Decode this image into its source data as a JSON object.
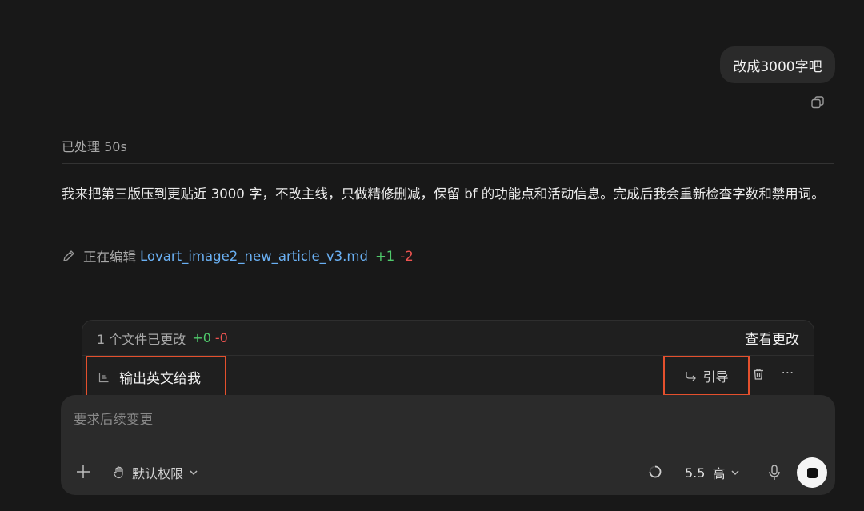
{
  "conversation": {
    "user_message": "改成3000字吧",
    "processed_label": "已处理 50s",
    "assistant_reply": "我来把第三版压到更贴近 3000 字，不改主线，只做精修删减，保留 bf 的功能点和活动信息。完成后我会重新检查字数和禁用词。",
    "edit_status": {
      "prefix": "正在编辑",
      "file_name": "Lovart_image2_new_article_v3.md",
      "added": "+1",
      "removed": "-2"
    }
  },
  "changes_panel": {
    "summary": "1 个文件已更改",
    "added": "+0",
    "removed": "-0",
    "view_changes_label": "查看更改",
    "queued_message": "输出英文给我",
    "guide_label": "引导"
  },
  "composer": {
    "placeholder": "要求后续变更",
    "permission_label": "默认权限",
    "model_version": "5.5",
    "model_level": "高"
  },
  "icons": {
    "copy": "copy-icon",
    "pencil": "pencil-icon",
    "queue": "queue-icon",
    "guide": "redirect-arrow-icon",
    "trash": "trash-icon",
    "more": "more-icon",
    "add": "plus-icon",
    "permission": "hand-icon",
    "chevron": "chevron-down-icon",
    "spinner": "spinner-icon",
    "mic": "microphone-icon",
    "stop": "stop-icon"
  },
  "colors": {
    "background": "#181818",
    "added": "#4fc96b",
    "removed": "#ef5350",
    "link": "#6ab0f3",
    "highlight_border": "#e4502d"
  }
}
